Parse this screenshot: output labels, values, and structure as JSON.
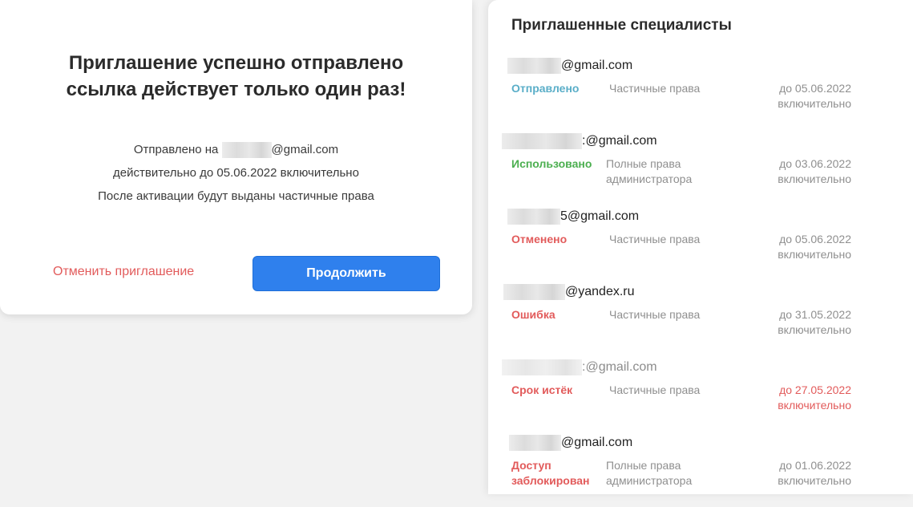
{
  "modal": {
    "title_line1": "Приглашение успешно отправлено",
    "title_line2": "ссылка действует только один раз!",
    "sent_to_prefix": "Отправлено на",
    "sent_to_domain": "@gmail.com",
    "valid_until": "действительно до 05.06.2022 включительно",
    "rights_note": "После активации будут выданы частичные права",
    "cancel_label": "Отменить приглашение",
    "continue_label": "Продолжить"
  },
  "panel": {
    "title": "Приглашенные специалисты",
    "invites": [
      {
        "domain": "@gmail.com",
        "status": "Отправлено",
        "status_color": "#5aaec8",
        "rights": "Частичные права",
        "date_line1": "до 05.06.2022",
        "date_line2": "включительно"
      },
      {
        "domain": ":@gmail.com",
        "status": "Использовано",
        "status_color": "#4caf50",
        "rights": "Полные права администратора",
        "date_line1": "до 03.06.2022",
        "date_line2": "включительно"
      },
      {
        "domain": "5@gmail.com",
        "status": "Отменено",
        "status_color": "#e25b5b",
        "rights": "Частичные права",
        "date_line1": "до 05.06.2022",
        "date_line2": "включительно"
      },
      {
        "domain": "@yandex.ru",
        "status": "Ошибка",
        "status_color": "#e25b5b",
        "rights": "Частичные права",
        "date_line1": "до 31.05.2022",
        "date_line2": "включительно"
      },
      {
        "domain": ":@gmail.com",
        "status": "Срок истёк",
        "status_color": "#e25b5b",
        "rights": "Частичные права",
        "date_line1": "до 27.05.2022",
        "date_line2": "включительно"
      },
      {
        "domain": "@gmail.com",
        "status": "Доступ заблокирован",
        "status_color": "#e25b5b",
        "rights": "Полные права администратора",
        "date_line1": "до 01.06.2022",
        "date_line2": "включительно"
      }
    ]
  },
  "colors": {
    "accent": "#2f80ed",
    "danger": "#e25b5b"
  }
}
